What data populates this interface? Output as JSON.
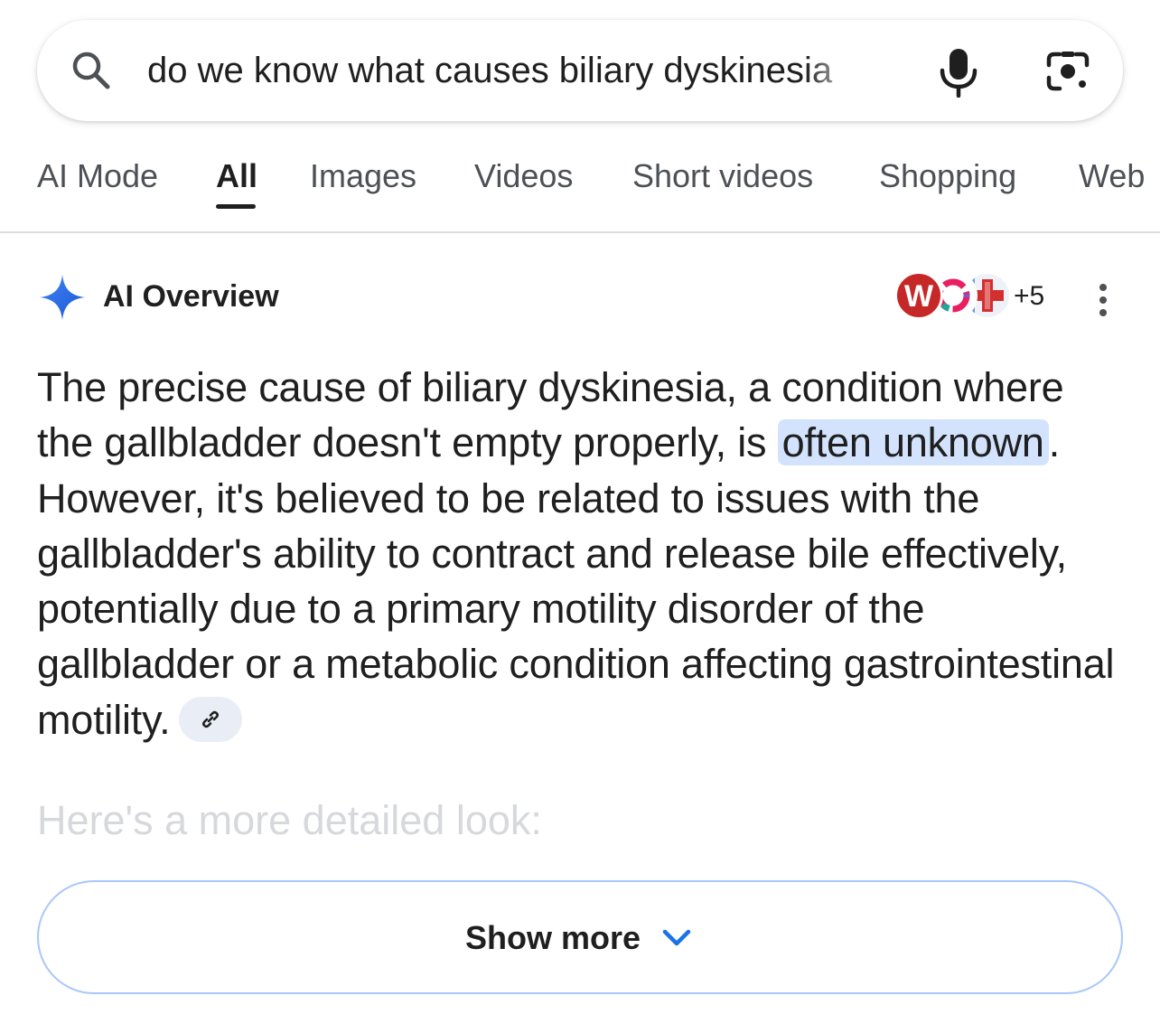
{
  "search": {
    "query": "do we know what causes biliary dyskinesia",
    "icon": "search-icon",
    "voice_icon": "microphone-icon",
    "lens_icon": "camera-lens-icon"
  },
  "tabs": [
    {
      "label": "AI Mode",
      "active": false
    },
    {
      "label": "All",
      "active": true
    },
    {
      "label": "Images",
      "active": false
    },
    {
      "label": "Videos",
      "active": false
    },
    {
      "label": "Short videos",
      "active": false
    },
    {
      "label": "Shopping",
      "active": false
    },
    {
      "label": "Web",
      "active": false
    }
  ],
  "ai_overview": {
    "title": "AI Overview",
    "icon": "gemini-spark-icon",
    "sources_more": "+5",
    "source_initial": "W",
    "text_before_highlight": "The precise cause of biliary dyskinesia, a condition where the gallbladder doesn't empty properly, is ",
    "highlight": "often unknown",
    "text_after_highlight": ". However, it's believed to be related to issues with the gallbladder's ability to contract and release bile effectively, potentially due to a primary motility disorder of the gallbladder or a metabolic condition affecting gastrointestinal motility.",
    "detail_intro": "Here's a more detailed look:",
    "show_more_label": "Show more"
  },
  "colors": {
    "accent_blue": "#1a73e8",
    "highlight_bg": "#d3e3fd",
    "show_more_border": "#a8c7fa",
    "source_red": "#c62828"
  }
}
